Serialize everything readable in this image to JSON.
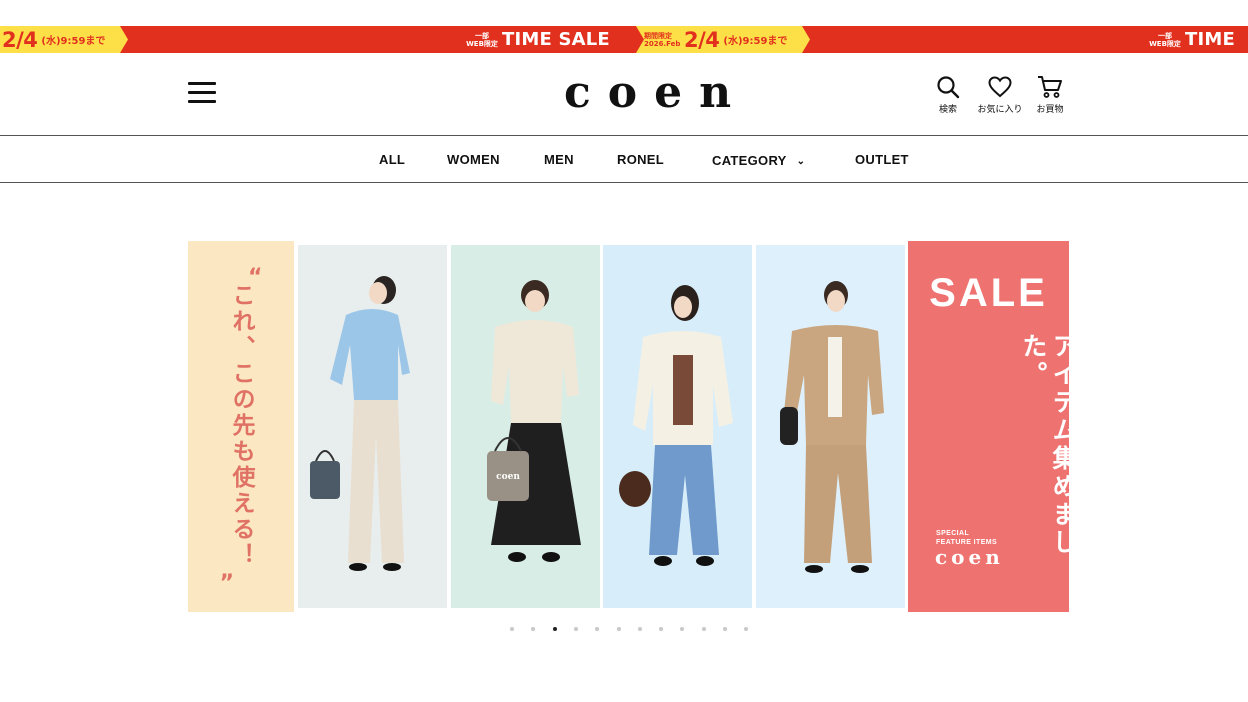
{
  "banner": {
    "left_date": "2/4",
    "left_weekday": "(水)9:59まで",
    "mid_small_1": "一部",
    "mid_small_2": "WEB限定",
    "mid_text": "TIME SALE",
    "tag_small_1": "期間限定",
    "tag_small_2": "2026.Feb",
    "tag_date": "2/4",
    "tag_weekday": "(水)9:59まで",
    "right_small_1": "一部",
    "right_small_2": "WEB限定",
    "right_text": "TIME",
    "colors": {
      "red": "#e1301e",
      "yellow": "#fde047"
    }
  },
  "header": {
    "menu_icon": "hamburger-menu-icon",
    "logo": "coen",
    "tools": [
      {
        "icon": "search-icon",
        "label": "検索"
      },
      {
        "icon": "heart-icon",
        "label": "お気に入り"
      },
      {
        "icon": "cart-icon",
        "label": "お買物"
      }
    ]
  },
  "nav": {
    "items": [
      "ALL",
      "WOMEN",
      "MEN",
      "RONEL",
      "CATEGORY",
      "OUTLET"
    ],
    "category_icon": "chevron-down-icon"
  },
  "hero": {
    "left_text": "これ、この先も使える！",
    "sale_title": "SALE",
    "sale_text": "アイテム集めました。",
    "feature_line_1": "SPECIAL",
    "feature_line_2": "FEATURE ITEMS",
    "feature_logo": "coen",
    "bag_logo": "coen",
    "colors": {
      "left_bg": "#fbe7c2",
      "left_text": "#e07265",
      "sale_bg": "#ee7370",
      "panel_1": "#e8eeee",
      "panel_2": "#d8ede6",
      "panel_3": "#d7eefa",
      "panel_4": "#def0fb"
    }
  },
  "carousel": {
    "dot_count": 12,
    "active_index": 2
  }
}
